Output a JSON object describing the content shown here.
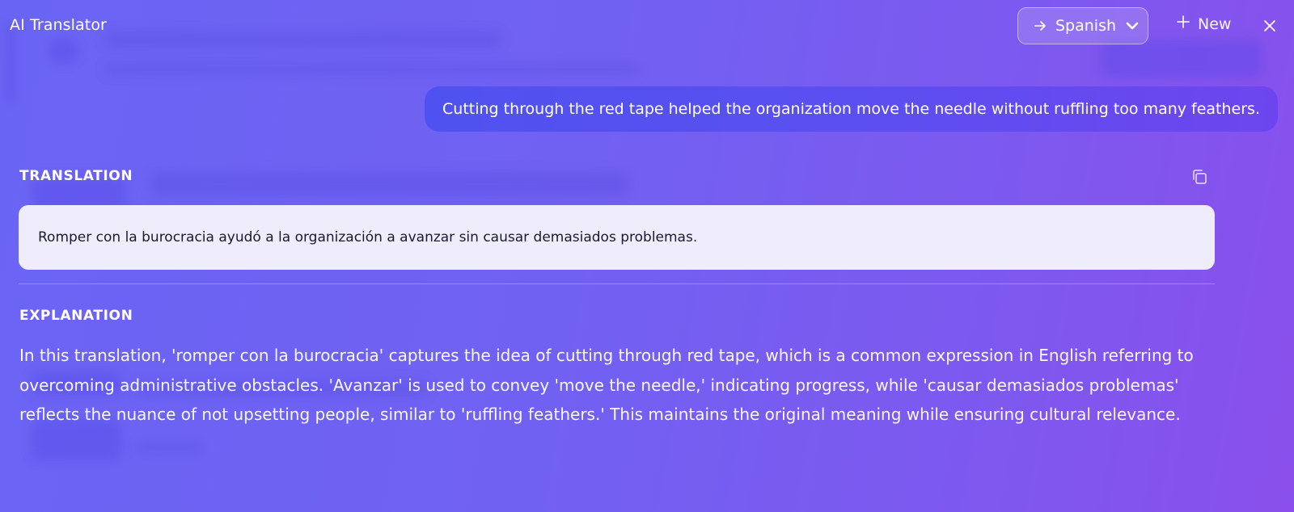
{
  "app": {
    "title": "AI Translator"
  },
  "header": {
    "target_language": "Spanish",
    "new_label": "New"
  },
  "source": {
    "text": "Cutting through the red tape helped the organization move the needle without ruffling too many feathers."
  },
  "translation": {
    "label": "TRANSLATION",
    "text": "Romper con la burocracia ayudó a la organización a avanzar sin causar demasiados problemas."
  },
  "explanation": {
    "label": "EXPLANATION",
    "text": "In this translation, 'romper con la burocracia' captures the idea of cutting through red tape, which is a common expression in English referring to overcoming administrative obstacles. 'Avanzar' is used to convey 'move the needle,' indicating progress, while 'causar demasiados problemas' reflects the nuance of not upsetting people, similar to 'ruffling feathers.' This maintains the original meaning while ensuring cultural relevance."
  },
  "icons": {
    "language": "arrow-right-icon",
    "dropdown": "chevron-down-icon",
    "new": "plus-icon",
    "close": "close-icon",
    "copy": "copy-icon"
  },
  "colors": {
    "background_start": "#6a64f4",
    "background_end": "#8a4fec",
    "source_bubble": "#5b4ff1",
    "translation_card": "#efedfb",
    "translation_text": "#1a1a2e"
  }
}
